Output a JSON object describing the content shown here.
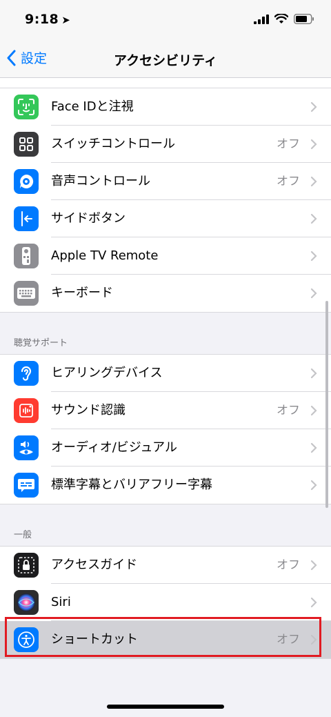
{
  "status": {
    "time": "9:18"
  },
  "nav": {
    "back_label": "設定",
    "title": "アクセシビリティ"
  },
  "groups": [
    {
      "header": "",
      "items": [
        {
          "label": "Face IDと注視",
          "value": "",
          "icon": "face-id-icon",
          "color": "#34c759"
        },
        {
          "label": "スイッチコントロール",
          "value": "オフ",
          "icon": "switch-control-icon",
          "color": "#3a3a3c"
        },
        {
          "label": "音声コントロール",
          "value": "オフ",
          "icon": "voice-control-icon",
          "color": "#007aff"
        },
        {
          "label": "サイドボタン",
          "value": "",
          "icon": "side-button-icon",
          "color": "#007aff"
        },
        {
          "label": "Apple TV Remote",
          "value": "",
          "icon": "tv-remote-icon",
          "color": "#8e8e93"
        },
        {
          "label": "キーボード",
          "value": "",
          "icon": "keyboard-icon",
          "color": "#8e8e93"
        }
      ]
    },
    {
      "header": "聴覚サポート",
      "items": [
        {
          "label": "ヒアリングデバイス",
          "value": "",
          "icon": "ear-icon",
          "color": "#007aff"
        },
        {
          "label": "サウンド認識",
          "value": "オフ",
          "icon": "sound-recognition-icon",
          "color": "#ff3b30"
        },
        {
          "label": "オーディオ/ビジュアル",
          "value": "",
          "icon": "audio-visual-icon",
          "color": "#007aff"
        },
        {
          "label": "標準字幕とバリアフリー字幕",
          "value": "",
          "icon": "subtitles-icon",
          "color": "#007aff"
        }
      ]
    },
    {
      "header": "一般",
      "items": [
        {
          "label": "アクセスガイド",
          "value": "オフ",
          "icon": "guided-access-icon",
          "color": "#1c1c1e"
        },
        {
          "label": "Siri",
          "value": "",
          "icon": "siri-icon",
          "color": "#2c2c2e"
        },
        {
          "label": "ショートカット",
          "value": "オフ",
          "icon": "accessibility-shortcut-icon",
          "color": "#007aff"
        }
      ]
    }
  ]
}
